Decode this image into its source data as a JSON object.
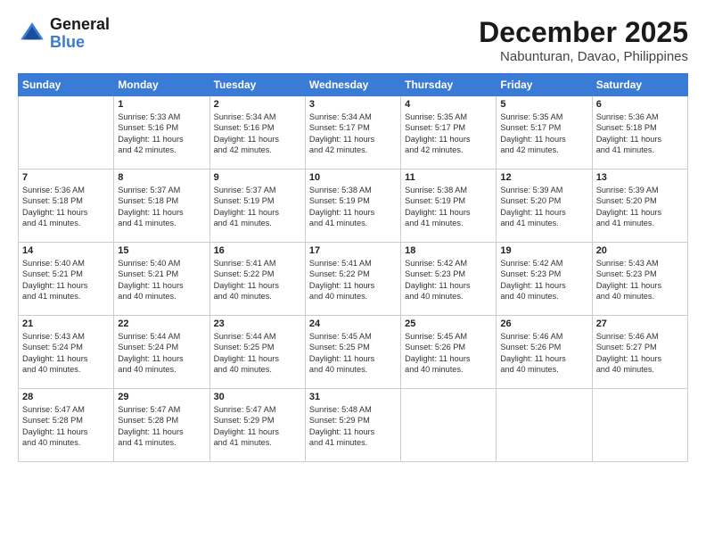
{
  "header": {
    "logo_line1": "General",
    "logo_line2": "Blue",
    "month": "December 2025",
    "location": "Nabunturan, Davao, Philippines"
  },
  "days_of_week": [
    "Sunday",
    "Monday",
    "Tuesday",
    "Wednesday",
    "Thursday",
    "Friday",
    "Saturday"
  ],
  "weeks": [
    [
      {
        "day": "",
        "detail": ""
      },
      {
        "day": "1",
        "detail": "Sunrise: 5:33 AM\nSunset: 5:16 PM\nDaylight: 11 hours\nand 42 minutes."
      },
      {
        "day": "2",
        "detail": "Sunrise: 5:34 AM\nSunset: 5:16 PM\nDaylight: 11 hours\nand 42 minutes."
      },
      {
        "day": "3",
        "detail": "Sunrise: 5:34 AM\nSunset: 5:17 PM\nDaylight: 11 hours\nand 42 minutes."
      },
      {
        "day": "4",
        "detail": "Sunrise: 5:35 AM\nSunset: 5:17 PM\nDaylight: 11 hours\nand 42 minutes."
      },
      {
        "day": "5",
        "detail": "Sunrise: 5:35 AM\nSunset: 5:17 PM\nDaylight: 11 hours\nand 42 minutes."
      },
      {
        "day": "6",
        "detail": "Sunrise: 5:36 AM\nSunset: 5:18 PM\nDaylight: 11 hours\nand 41 minutes."
      }
    ],
    [
      {
        "day": "7",
        "detail": "Sunrise: 5:36 AM\nSunset: 5:18 PM\nDaylight: 11 hours\nand 41 minutes."
      },
      {
        "day": "8",
        "detail": "Sunrise: 5:37 AM\nSunset: 5:18 PM\nDaylight: 11 hours\nand 41 minutes."
      },
      {
        "day": "9",
        "detail": "Sunrise: 5:37 AM\nSunset: 5:19 PM\nDaylight: 11 hours\nand 41 minutes."
      },
      {
        "day": "10",
        "detail": "Sunrise: 5:38 AM\nSunset: 5:19 PM\nDaylight: 11 hours\nand 41 minutes."
      },
      {
        "day": "11",
        "detail": "Sunrise: 5:38 AM\nSunset: 5:19 PM\nDaylight: 11 hours\nand 41 minutes."
      },
      {
        "day": "12",
        "detail": "Sunrise: 5:39 AM\nSunset: 5:20 PM\nDaylight: 11 hours\nand 41 minutes."
      },
      {
        "day": "13",
        "detail": "Sunrise: 5:39 AM\nSunset: 5:20 PM\nDaylight: 11 hours\nand 41 minutes."
      }
    ],
    [
      {
        "day": "14",
        "detail": "Sunrise: 5:40 AM\nSunset: 5:21 PM\nDaylight: 11 hours\nand 41 minutes."
      },
      {
        "day": "15",
        "detail": "Sunrise: 5:40 AM\nSunset: 5:21 PM\nDaylight: 11 hours\nand 40 minutes."
      },
      {
        "day": "16",
        "detail": "Sunrise: 5:41 AM\nSunset: 5:22 PM\nDaylight: 11 hours\nand 40 minutes."
      },
      {
        "day": "17",
        "detail": "Sunrise: 5:41 AM\nSunset: 5:22 PM\nDaylight: 11 hours\nand 40 minutes."
      },
      {
        "day": "18",
        "detail": "Sunrise: 5:42 AM\nSunset: 5:23 PM\nDaylight: 11 hours\nand 40 minutes."
      },
      {
        "day": "19",
        "detail": "Sunrise: 5:42 AM\nSunset: 5:23 PM\nDaylight: 11 hours\nand 40 minutes."
      },
      {
        "day": "20",
        "detail": "Sunrise: 5:43 AM\nSunset: 5:23 PM\nDaylight: 11 hours\nand 40 minutes."
      }
    ],
    [
      {
        "day": "21",
        "detail": "Sunrise: 5:43 AM\nSunset: 5:24 PM\nDaylight: 11 hours\nand 40 minutes."
      },
      {
        "day": "22",
        "detail": "Sunrise: 5:44 AM\nSunset: 5:24 PM\nDaylight: 11 hours\nand 40 minutes."
      },
      {
        "day": "23",
        "detail": "Sunrise: 5:44 AM\nSunset: 5:25 PM\nDaylight: 11 hours\nand 40 minutes."
      },
      {
        "day": "24",
        "detail": "Sunrise: 5:45 AM\nSunset: 5:25 PM\nDaylight: 11 hours\nand 40 minutes."
      },
      {
        "day": "25",
        "detail": "Sunrise: 5:45 AM\nSunset: 5:26 PM\nDaylight: 11 hours\nand 40 minutes."
      },
      {
        "day": "26",
        "detail": "Sunrise: 5:46 AM\nSunset: 5:26 PM\nDaylight: 11 hours\nand 40 minutes."
      },
      {
        "day": "27",
        "detail": "Sunrise: 5:46 AM\nSunset: 5:27 PM\nDaylight: 11 hours\nand 40 minutes."
      }
    ],
    [
      {
        "day": "28",
        "detail": "Sunrise: 5:47 AM\nSunset: 5:28 PM\nDaylight: 11 hours\nand 40 minutes."
      },
      {
        "day": "29",
        "detail": "Sunrise: 5:47 AM\nSunset: 5:28 PM\nDaylight: 11 hours\nand 41 minutes."
      },
      {
        "day": "30",
        "detail": "Sunrise: 5:47 AM\nSunset: 5:29 PM\nDaylight: 11 hours\nand 41 minutes."
      },
      {
        "day": "31",
        "detail": "Sunrise: 5:48 AM\nSunset: 5:29 PM\nDaylight: 11 hours\nand 41 minutes."
      },
      {
        "day": "",
        "detail": ""
      },
      {
        "day": "",
        "detail": ""
      },
      {
        "day": "",
        "detail": ""
      }
    ]
  ]
}
